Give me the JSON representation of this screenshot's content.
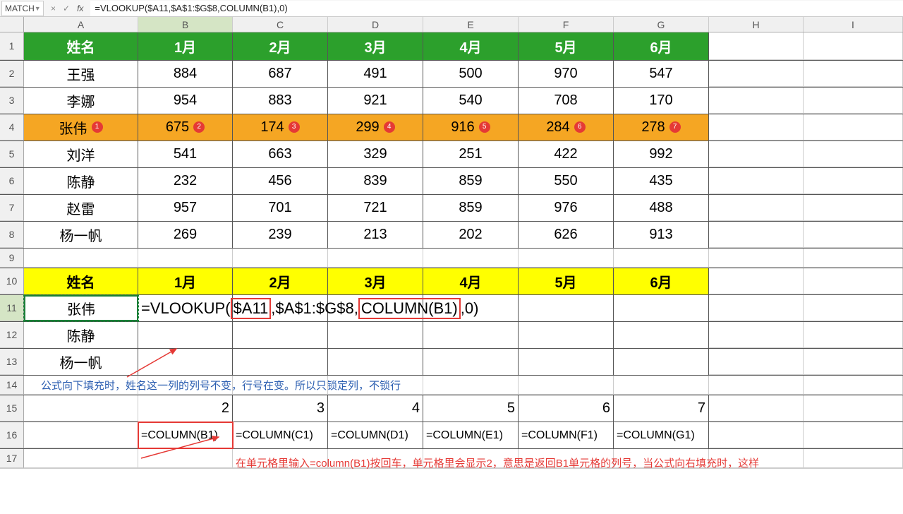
{
  "formula_bar": {
    "name_box": "MATCH",
    "cancel": "×",
    "confirm": "✓",
    "fx": "fx",
    "formula": "=VLOOKUP($A11,$A$1:$G$8,COLUMN(B1),0)"
  },
  "col_headers": [
    "A",
    "B",
    "C",
    "D",
    "E",
    "F",
    "G",
    "H",
    "I"
  ],
  "rows": {
    "1": [
      "姓名",
      "1月",
      "2月",
      "3月",
      "4月",
      "5月",
      "6月",
      "",
      ""
    ],
    "2": [
      "王强",
      "884",
      "687",
      "491",
      "500",
      "970",
      "547",
      "",
      ""
    ],
    "3": [
      "李娜",
      "954",
      "883",
      "921",
      "540",
      "708",
      "170",
      "",
      ""
    ],
    "4": [
      "张伟",
      "675",
      "174",
      "299",
      "916",
      "284",
      "278",
      "",
      ""
    ],
    "4_badges": [
      "1",
      "2",
      "3",
      "4",
      "5",
      "6",
      "7"
    ],
    "5": [
      "刘洋",
      "541",
      "663",
      "329",
      "251",
      "422",
      "992",
      "",
      ""
    ],
    "6": [
      "陈静",
      "232",
      "456",
      "839",
      "859",
      "550",
      "435",
      "",
      ""
    ],
    "7": [
      "赵雷",
      "957",
      "701",
      "721",
      "859",
      "976",
      "488",
      "",
      ""
    ],
    "8": [
      "杨一帆",
      "269",
      "239",
      "213",
      "202",
      "626",
      "913",
      "",
      ""
    ],
    "10": [
      "姓名",
      "1月",
      "2月",
      "3月",
      "4月",
      "5月",
      "6月",
      "",
      ""
    ],
    "11": [
      "张伟",
      "",
      "",
      "",
      "",
      "",
      "",
      "",
      ""
    ],
    "11_formula_parts": {
      "pre": "=VLOOKUP(",
      "a": "$A11",
      "mid": ",$A$1:$G$8,",
      "col": "COLUMN(B1)",
      "post": ",0)"
    },
    "12": [
      "陈静",
      "",
      "",
      "",
      "",
      "",
      "",
      "",
      ""
    ],
    "13": [
      "杨一帆",
      "",
      "",
      "",
      "",
      "",
      "",
      "",
      ""
    ],
    "15": [
      "",
      "2",
      "3",
      "4",
      "5",
      "6",
      "7",
      "",
      ""
    ],
    "16": [
      "",
      "=COLUMN(B1)",
      "=COLUMN(C1)",
      "=COLUMN(D1)",
      "=COLUMN(E1)",
      "=COLUMN(F1)",
      "=COLUMN(G1)",
      "",
      ""
    ]
  },
  "notes": {
    "row14": "公式向下填充时，姓名这一列的列号不变，行号在变。所以只锁定列，不锁行",
    "bottom": "在单元格里输入=column(B1)按回车，单元格里会显示2，意思是返回B1单元格的列号，当公式向右填充时，这样"
  },
  "chart_data": {
    "type": "table",
    "title": "Monthly data by name",
    "columns": [
      "姓名",
      "1月",
      "2月",
      "3月",
      "4月",
      "5月",
      "6月"
    ],
    "rows": [
      {
        "姓名": "王强",
        "1月": 884,
        "2月": 687,
        "3月": 491,
        "4月": 500,
        "5月": 970,
        "6月": 547
      },
      {
        "姓名": "李娜",
        "1月": 954,
        "2月": 883,
        "3月": 921,
        "4月": 540,
        "5月": 708,
        "6月": 170
      },
      {
        "姓名": "张伟",
        "1月": 675,
        "2月": 174,
        "3月": 299,
        "4月": 916,
        "5月": 284,
        "6月": 278
      },
      {
        "姓名": "刘洋",
        "1月": 541,
        "2月": 663,
        "3月": 329,
        "4月": 251,
        "5月": 422,
        "6月": 992
      },
      {
        "姓名": "陈静",
        "1月": 232,
        "2月": 456,
        "3月": 839,
        "4月": 859,
        "5月": 550,
        "6月": 435
      },
      {
        "姓名": "赵雷",
        "1月": 957,
        "2月": 701,
        "3月": 721,
        "4月": 859,
        "5月": 976,
        "6月": 488
      },
      {
        "姓名": "杨一帆",
        "1月": 269,
        "2月": 239,
        "3月": 213,
        "4月": 202,
        "5月": 626,
        "6月": 913
      }
    ],
    "lookup_names": [
      "张伟",
      "陈静",
      "杨一帆"
    ],
    "column_formula_row": {
      "B": "=COLUMN(B1)",
      "C": "=COLUMN(C1)",
      "D": "=COLUMN(D1)",
      "E": "=COLUMN(E1)",
      "F": "=COLUMN(F1)",
      "G": "=COLUMN(G1)"
    },
    "column_formula_results": [
      2,
      3,
      4,
      5,
      6,
      7
    ]
  }
}
